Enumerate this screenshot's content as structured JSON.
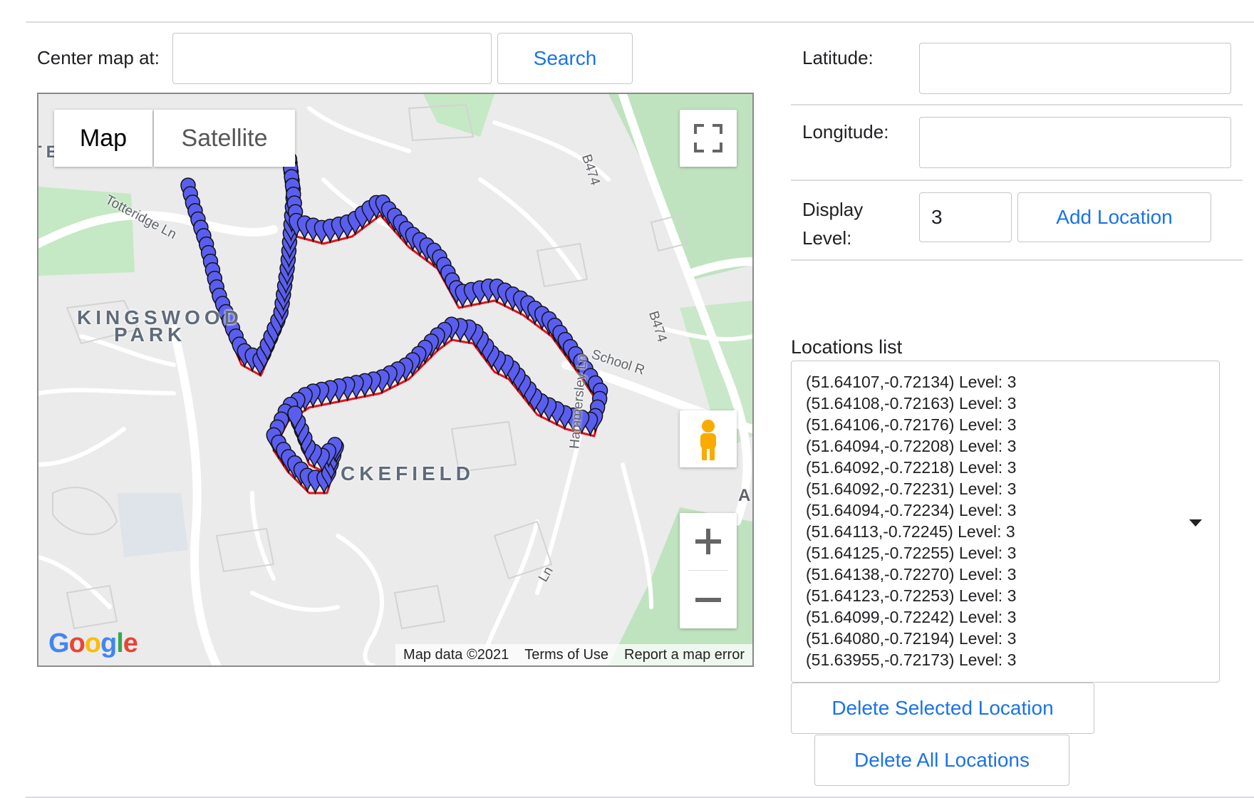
{
  "search": {
    "label": "Center map at:",
    "value": "",
    "button": "Search"
  },
  "form": {
    "latitude_label": "Latitude:",
    "latitude_value": "",
    "longitude_label": "Longitude:",
    "longitude_value": "",
    "display_level_label_1": "Display",
    "display_level_label_2": "Level:",
    "display_level_value": "3",
    "add_button": "Add Location"
  },
  "map": {
    "type_map": "Map",
    "type_satellite": "Satellite",
    "logo": "Google",
    "attribution": {
      "data": "Map data ©2021",
      "terms": "Terms of Use",
      "report": "Report a map error"
    },
    "places": {
      "kingswood_1": "KINGSWOOD",
      "kingswood_2": "PARK",
      "hazlefield": "CKEFIELD",
      "top_left": "TERIDGE"
    },
    "roads": {
      "totteridge": "Totteridge Ln",
      "b474_top": "B474",
      "b474_mid": "B474",
      "school": "School R",
      "hammersley": "Hammersley Ln",
      "ln_bottom": "Ln",
      "edge_a": "A"
    },
    "icons": [
      "fullscreen-icon",
      "pegman-icon",
      "zoom-in-icon",
      "zoom-out-icon"
    ],
    "marker_color": "#5a5ef0",
    "route_color": "#e8101b"
  },
  "locations": {
    "title": "Locations list",
    "items": [
      "(51.64107,-0.72134) Level: 3",
      "(51.64108,-0.72163) Level: 3",
      "(51.64106,-0.72176) Level: 3",
      "(51.64094,-0.72208) Level: 3",
      "(51.64092,-0.72218) Level: 3",
      "(51.64092,-0.72231) Level: 3",
      "(51.64094,-0.72234) Level: 3",
      "(51.64113,-0.72245) Level: 3",
      "(51.64125,-0.72255) Level: 3",
      "(51.64138,-0.72270) Level: 3",
      "(51.64123,-0.72253) Level: 3",
      "(51.64099,-0.72242) Level: 3",
      "(51.64080,-0.72194) Level: 3",
      "(51.63955,-0.72173) Level: 3"
    ],
    "delete_selected": "Delete Selected Location",
    "delete_all": "Delete All Locations"
  }
}
